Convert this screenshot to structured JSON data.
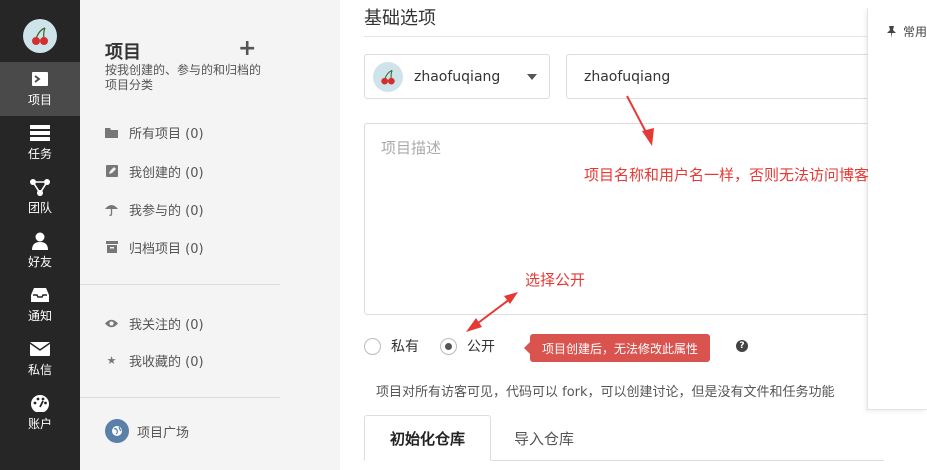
{
  "nav": {
    "items": [
      {
        "label": "项目",
        "icon": "project-icon",
        "active": true
      },
      {
        "label": "任务",
        "icon": "task-icon"
      },
      {
        "label": "团队",
        "icon": "team-icon"
      },
      {
        "label": "好友",
        "icon": "friend-icon"
      },
      {
        "label": "通知",
        "icon": "inbox-icon"
      },
      {
        "label": "私信",
        "icon": "mail-icon"
      },
      {
        "label": "账户",
        "icon": "dashboard-icon"
      }
    ]
  },
  "sidebar": {
    "title": "项目",
    "add_icon": "+",
    "description": "按我创建的、参与的和归档的项目分类",
    "items": [
      {
        "label": "所有项目 (0)",
        "icon": "folder-icon"
      },
      {
        "label": "我创建的 (0)",
        "icon": "edit-icon"
      },
      {
        "label": "我参与的 (0)",
        "icon": "umbrella-icon"
      },
      {
        "label": "归档项目 (0)",
        "icon": "archive-icon"
      },
      {
        "label": "我关注的 (0)",
        "icon": "eye-icon"
      },
      {
        "label": "我收藏的 (0)",
        "icon": "star-icon"
      },
      {
        "label": "项目广场",
        "icon": "globe-icon"
      }
    ]
  },
  "form": {
    "section_title": "基础选项",
    "owner": "zhaofuqiang",
    "project_name": "zhaofuqiang",
    "description_placeholder": "项目描述",
    "visibility": {
      "private_label": "私有",
      "public_label": "公开",
      "selected": "public"
    },
    "warning_badge": "项目创建后，无法修改此属性",
    "help_icon": "?",
    "hint": "项目对所有访客可见，代码可以 fork，可以创建讨论，但是没有文件和任务功能",
    "tabs": [
      "初始化仓库",
      "导入仓库"
    ]
  },
  "right_panel": {
    "label": "常用"
  },
  "annotations": {
    "name_note": "项目名称和用户名一样，否则无法访问博客",
    "public_note": "选择公开",
    "color": "#e53935"
  },
  "colors": {
    "nav_bg": "#262626",
    "nav_active": "#4a4a4a",
    "sidebar_bg": "#f4f4f4",
    "badge_bg": "#d9534f"
  }
}
